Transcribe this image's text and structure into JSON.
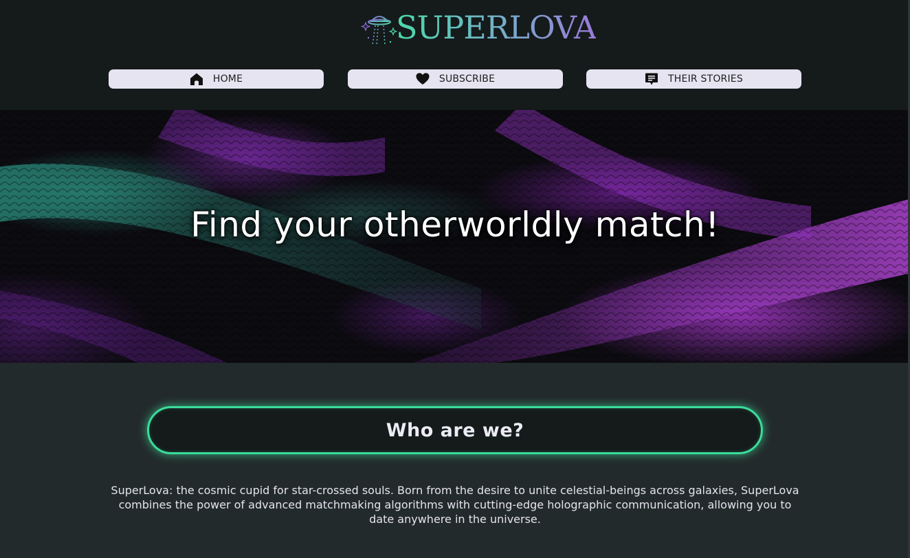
{
  "brand": {
    "name": "SUPERLOVA",
    "icon": "ufo-icon"
  },
  "nav": [
    {
      "label": "HOME",
      "icon": "home-icon"
    },
    {
      "label": "SUBSCRIBE",
      "icon": "heart-icon"
    },
    {
      "label": "THEIR STORIES",
      "icon": "chat-icon"
    }
  ],
  "hero": {
    "title": "Find your otherworldly match!"
  },
  "about": {
    "heading": "Who are we?",
    "text": "SuperLova: the cosmic cupid for star-crossed souls. Born from the desire to unite celestial-beings across galaxies, SuperLova combines the power of advanced matchmaking algorithms with cutting-edge holographic communication, allowing you to date anywhere in the universe."
  },
  "colors": {
    "accent": "#3bdc9c",
    "header_bg": "#151a1b",
    "page_bg": "#232a2b",
    "nav_bg": "#e6e4f0"
  }
}
